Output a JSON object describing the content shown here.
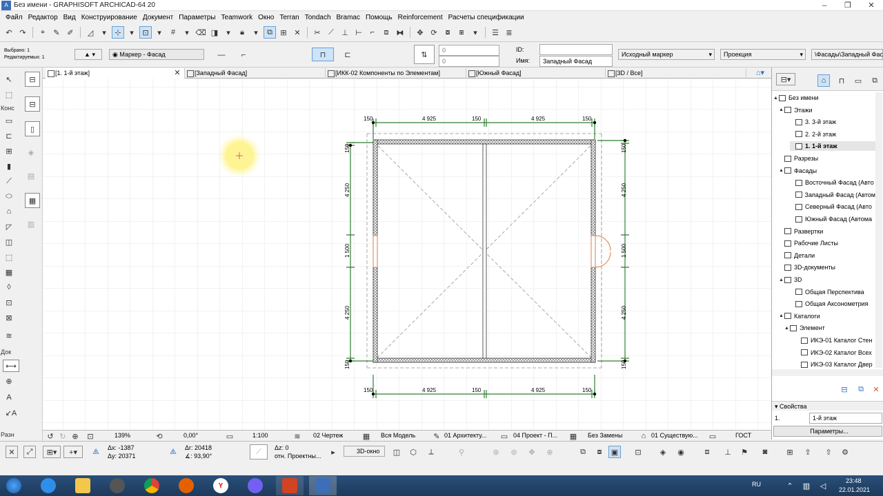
{
  "window": {
    "title": "Без имени - GRAPHISOFT ARCHICAD-64 20",
    "min": "–",
    "max": "❐",
    "close": "✕"
  },
  "menu": [
    "Файл",
    "Редактор",
    "Вид",
    "Конструирование",
    "Документ",
    "Параметры",
    "Teamwork",
    "Окно",
    "Terran",
    "Tondach",
    "Bramac",
    "Помощь",
    "Reinforcement",
    "Расчеты спецификации"
  ],
  "info": {
    "selected": "Выбрано: 1",
    "editable": "Редактируемых: 1",
    "marker": "Маркер - Фасад",
    "val1": "0",
    "val2": "0",
    "id_label": "ID:",
    "name_label": "Имя:",
    "id_value": "",
    "name_value": "Западный Фасад",
    "source_marker": "Исходный маркер",
    "projection": "Проекция",
    "path": "\\Фасады\\Западный Фасад"
  },
  "tabs": [
    "[1. 1-й этаж]",
    "[Западный Фасад]",
    "[ИКК-02 Компоненты по Элементам]",
    "[Южный Фасад]",
    "[3D / Все]"
  ],
  "left_groups": {
    "konstr": "Конс",
    "doc": "Док",
    "raz": "Разн"
  },
  "plan": {
    "top_dims": [
      "150",
      "4 925",
      "150",
      "4 925",
      "150"
    ],
    "bottom_dims": [
      "150",
      "4 925",
      "150",
      "4 925",
      "150"
    ],
    "left_dims": [
      "150",
      "4 250",
      "1 500",
      "4 250",
      "150"
    ],
    "right_dims": [
      "150",
      "4 250",
      "1 500",
      "4 250",
      "150"
    ]
  },
  "navigator": [
    {
      "label": "Без имени",
      "lvl": 0,
      "tri": "▲"
    },
    {
      "label": "Этажи",
      "lvl": 1,
      "tri": "▲"
    },
    {
      "label": "3. 3-й этаж",
      "lvl": 3,
      "tri": ""
    },
    {
      "label": "2. 2-й этаж",
      "lvl": 3,
      "tri": ""
    },
    {
      "label": "1. 1-й этаж",
      "lvl": 3,
      "tri": "",
      "sel": true
    },
    {
      "label": "Разрезы",
      "lvl": 1,
      "tri": ""
    },
    {
      "label": "Фасады",
      "lvl": 1,
      "tri": "▲"
    },
    {
      "label": "Восточный Фасад (Авто",
      "lvl": 3,
      "tri": ""
    },
    {
      "label": "Западный Фасад (Автом",
      "lvl": 3,
      "tri": ""
    },
    {
      "label": "Северный Фасад (Авто",
      "lvl": 3,
      "tri": ""
    },
    {
      "label": "Южный Фасад (Автома",
      "lvl": 3,
      "tri": ""
    },
    {
      "label": "Развертки",
      "lvl": 1,
      "tri": ""
    },
    {
      "label": "Рабочие Листы",
      "lvl": 1,
      "tri": ""
    },
    {
      "label": "Детали",
      "lvl": 1,
      "tri": ""
    },
    {
      "label": "3D-документы",
      "lvl": 1,
      "tri": ""
    },
    {
      "label": "3D",
      "lvl": 1,
      "tri": "▲"
    },
    {
      "label": "Общая Перспектива",
      "lvl": 3,
      "tri": ""
    },
    {
      "label": "Общая Аксонометрия",
      "lvl": 3,
      "tri": ""
    },
    {
      "label": "Каталоги",
      "lvl": 1,
      "tri": "▲"
    },
    {
      "label": "Элемент",
      "lvl": 2,
      "tri": "▲"
    },
    {
      "label": "ИКЭ-01 Каталог Стен",
      "lvl": 4,
      "tri": ""
    },
    {
      "label": "ИКЭ-02 Каталог Всех",
      "lvl": 4,
      "tri": ""
    },
    {
      "label": "ИКЭ-03 Каталог Двер",
      "lvl": 4,
      "tri": ""
    }
  ],
  "properties": {
    "title": "Свойства",
    "num": "1.",
    "value": "1-й этаж",
    "button": "Параметры..."
  },
  "status": {
    "zoom": "139%",
    "angle": "0,00°",
    "scale": "1:100",
    "layer_combo": "02 Чертеж",
    "model": "Вся Модель",
    "pen": "01 Архитекту...",
    "proj": "04 Проект - П...",
    "override": "Без Замены",
    "renov": "01 Существую...",
    "std": "ГОСТ"
  },
  "coords": {
    "dx": "Δx: -1387",
    "dy": "Δy: 20371",
    "dr": "Δr: 20418",
    "da": "∡: 93,90°",
    "dz": "Δz: 0",
    "rel": "отн. Проектны...",
    "view3d": "3D-окно"
  },
  "taskbar": {
    "lang": "RU",
    "time": "23:48",
    "date": "22.01.2021"
  }
}
